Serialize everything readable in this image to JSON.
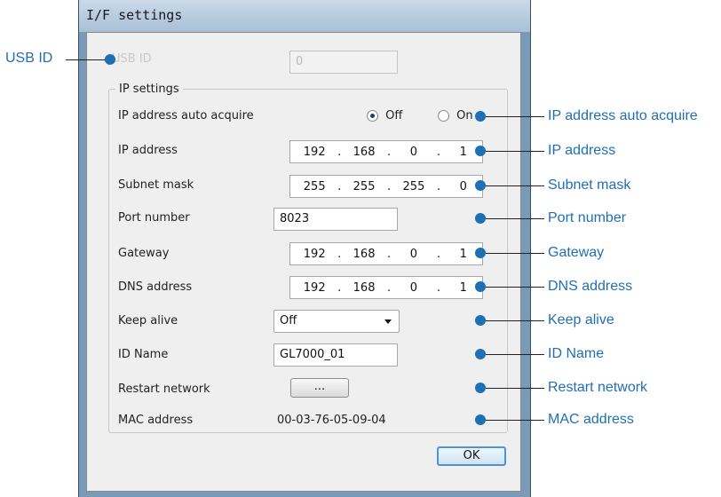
{
  "window": {
    "title": "I/F settings"
  },
  "usb_id": {
    "label": "USB ID",
    "value": "0"
  },
  "ip_settings": {
    "group_title": "IP settings",
    "auto_acquire": {
      "label": "IP address auto acquire",
      "off_label": "Off",
      "on_label": "On",
      "selected": "Off"
    },
    "ip_address": {
      "label": "IP address",
      "octets": [
        "192",
        "168",
        "0",
        "1"
      ]
    },
    "subnet_mask": {
      "label": "Subnet mask",
      "octets": [
        "255",
        "255",
        "255",
        "0"
      ]
    },
    "port_number": {
      "label": "Port number",
      "value": "8023"
    },
    "gateway": {
      "label": "Gateway",
      "octets": [
        "192",
        "168",
        "0",
        "1"
      ]
    },
    "dns_address": {
      "label": "DNS address",
      "octets": [
        "192",
        "168",
        "0",
        "1"
      ]
    },
    "keep_alive": {
      "label": "Keep alive",
      "value": "Off"
    },
    "id_name": {
      "label": "ID Name",
      "value": "GL7000_01"
    },
    "restart_network": {
      "label": "Restart network",
      "button_label": "..."
    },
    "mac_address": {
      "label": "MAC address",
      "value": "00-03-76-05-09-04"
    }
  },
  "ok_button": {
    "label": "OK"
  },
  "callouts": {
    "usb_id": "USB ID",
    "ip_auto": "IP address auto acquire",
    "ip_address": "IP address",
    "subnet_mask": "Subnet mask",
    "port_number": "Port number",
    "gateway": "Gateway",
    "dns_address": "DNS address",
    "keep_alive": "Keep alive",
    "id_name": "ID Name",
    "restart_network": "Restart network",
    "mac_address": "MAC address"
  },
  "colors": {
    "callout": "#1f6fb5",
    "ok_border": "#4f93d4"
  }
}
